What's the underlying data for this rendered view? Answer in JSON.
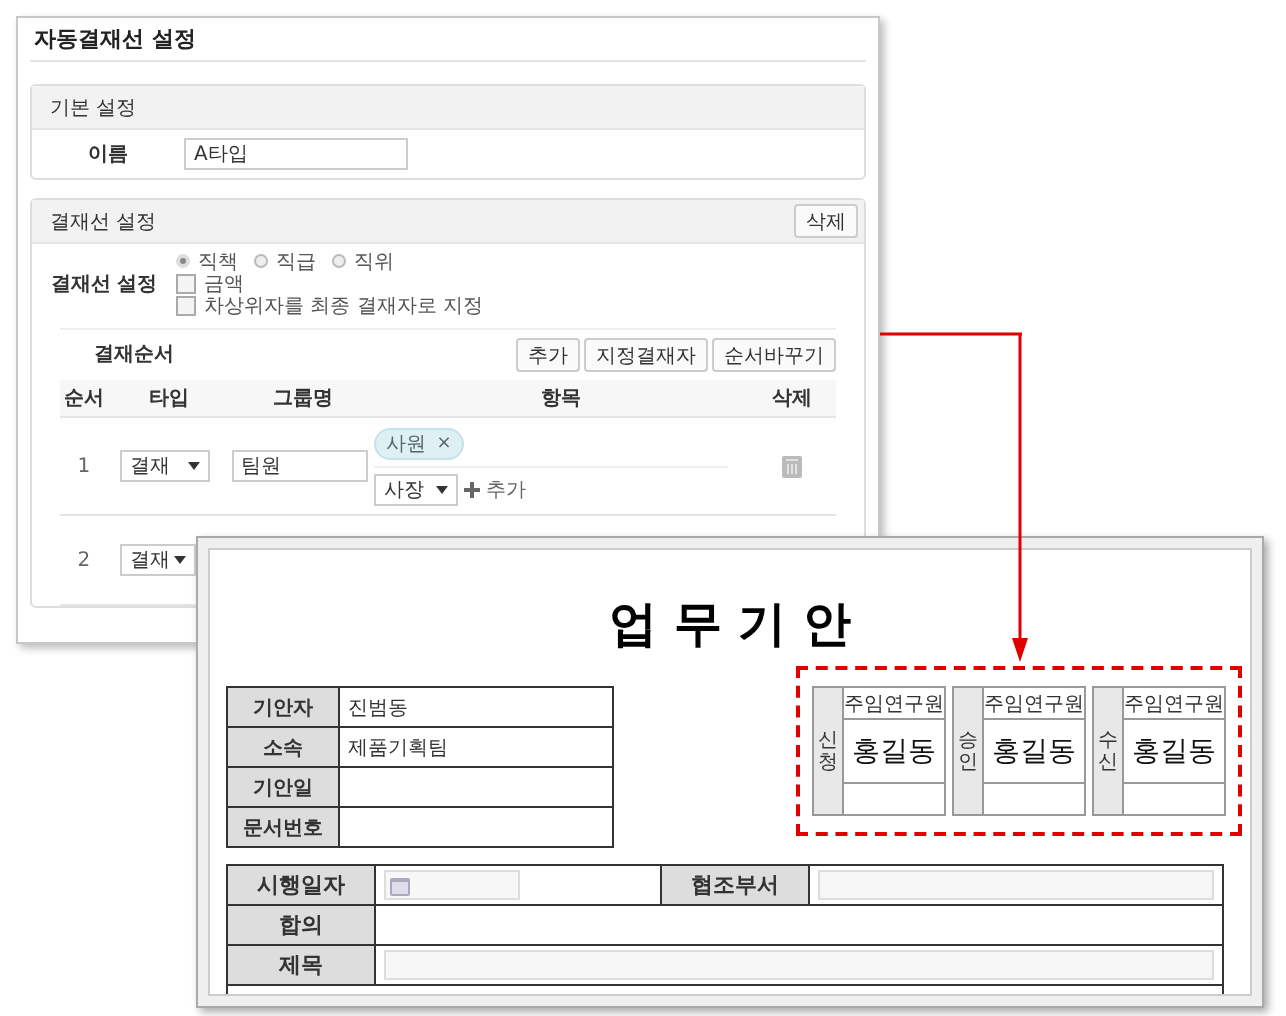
{
  "settings": {
    "title": "자동결재선 설정",
    "basic_section": {
      "title": "기본 설정",
      "name_label": "이름",
      "name_value": "A타입"
    },
    "line_section": {
      "title": "결재선 설정",
      "delete_button": "삭제",
      "setting_label": "결재선 설정",
      "radios": [
        {
          "label": "직책",
          "selected": true
        },
        {
          "label": "직급",
          "selected": false
        },
        {
          "label": "직위",
          "selected": false
        }
      ],
      "checkboxes": [
        {
          "label": "금액",
          "checked": false
        },
        {
          "label": "차상위자를 최종 결재자로 지정",
          "checked": false
        }
      ],
      "order_label": "결재순서",
      "buttons": [
        "추가",
        "지정결재자",
        "순서바꾸기"
      ],
      "columns": [
        "순서",
        "타입",
        "그룹명",
        "항목",
        "삭제"
      ],
      "rows": [
        {
          "order": "1",
          "type": "결재",
          "group": "팀원",
          "chips": [
            {
              "label": "사원",
              "remove": "×"
            }
          ],
          "item_select": "사장",
          "add_link": "추가"
        },
        {
          "order": "2",
          "type": "결재"
        }
      ]
    }
  },
  "document": {
    "title": "업 무 기 안",
    "info": [
      {
        "label": "기안자",
        "value": "진범동"
      },
      {
        "label": "소속",
        "value": "제품기획팀"
      },
      {
        "label": "기안일"
      },
      {
        "label": "문서번호"
      }
    ],
    "approvals": [
      {
        "label": "신청",
        "position": "주임연구원",
        "name": "홍길동"
      },
      {
        "label": "승인",
        "position": "주임연구원",
        "name": "홍길동"
      },
      {
        "label": "수신",
        "position": "주임연구원",
        "name": "홍길동"
      }
    ],
    "field_rows": [
      [
        {
          "label": "시행일자",
          "kind": "date"
        },
        {
          "label": "협조부서",
          "kind": "text"
        }
      ],
      [
        {
          "label": "합의",
          "kind": "plain"
        }
      ],
      [
        {
          "label": "제목",
          "kind": "text"
        }
      ]
    ]
  }
}
